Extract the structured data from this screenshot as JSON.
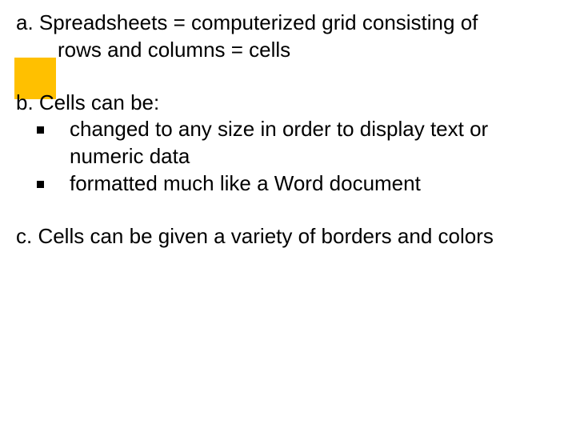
{
  "slide": {
    "a": {
      "line1": "a. Spreadsheets = computerized grid consisting of",
      "line2": "rows and columns = cells"
    },
    "b": {
      "lead": "b. Cells can be:",
      "sub1": "changed to any size in order to display text or numeric data",
      "sub2": "formatted much like a Word document"
    },
    "c": {
      "text": "c. Cells can be given a variety of borders and colors"
    }
  }
}
